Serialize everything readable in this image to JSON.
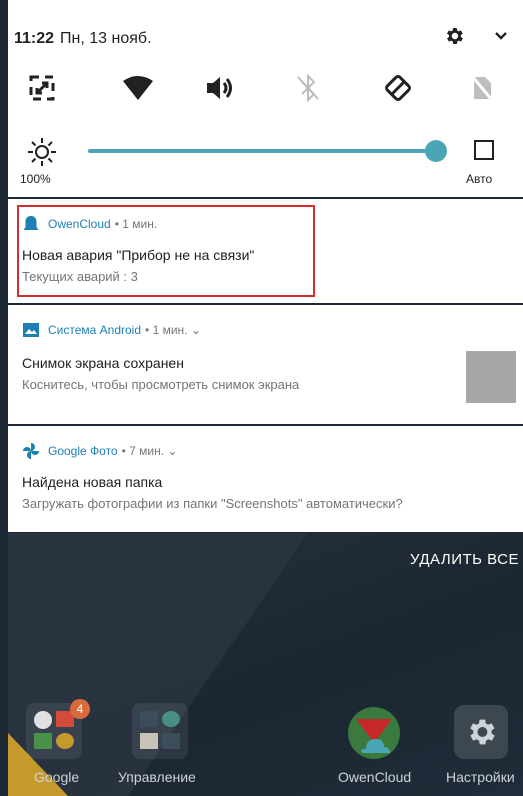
{
  "status": {
    "time": "11:22",
    "date": "Пн, 13 нояб."
  },
  "quick_settings": {
    "brightness_percent": "100%",
    "auto_label": "Авто",
    "brightness_level": 1.0
  },
  "notifications": [
    {
      "app": "OwenCloud",
      "meta": "• 1 мин.",
      "title": "Новая авария \"Прибор не на связи\"",
      "text": "Текущих аварий : 3"
    },
    {
      "app": "Система Android",
      "meta": "• 1 мин. ⌄",
      "title": "Снимок экрана сохранен",
      "text": "Коснитесь, чтобы просмотреть снимок экрана"
    },
    {
      "app": "Google Фото",
      "meta": "• 7 мин. ⌄",
      "title": "Найдена новая папка",
      "text": "Загружать фотографии из папки \"Screenshots\" автоматически?"
    }
  ],
  "clear_all": "УДАЛИТЬ ВСЕ",
  "dock": [
    {
      "label": "Google",
      "badge": "4"
    },
    {
      "label": "Управление"
    },
    {
      "label": "OwenCloud"
    },
    {
      "label": "Настройки"
    }
  ],
  "colors": {
    "accent": "#4aa5b5",
    "highlight": "#d32f2f",
    "app_name": "#1e7fb3"
  }
}
